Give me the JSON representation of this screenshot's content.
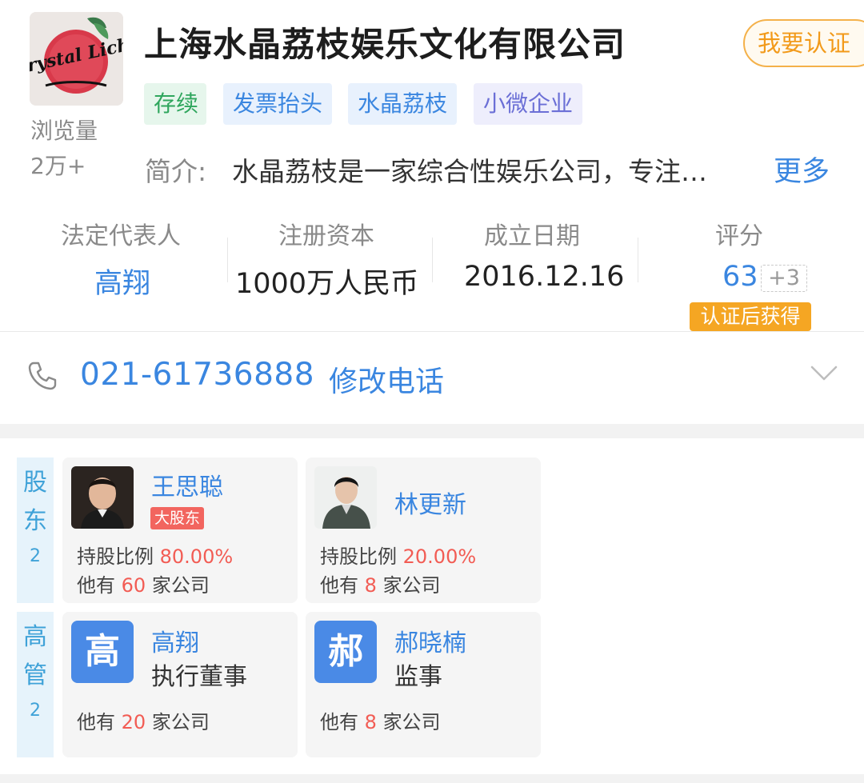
{
  "header": {
    "logo_text": "Crystal Lichi",
    "views_label": "浏览量",
    "views_count": "2万+",
    "company_name": "上海水晶荔枝娱乐文化有限公司",
    "verify_button": "我要认证",
    "tags": [
      "存续",
      "发票抬头",
      "水晶荔枝",
      "小微企业"
    ],
    "intro_label": "简介:",
    "intro_text": "水晶荔枝是一家综合性娱乐公司，专注…",
    "intro_more": "更多"
  },
  "stats": {
    "legal_rep_label": "法定代表人",
    "legal_rep_value": "高翔",
    "capital_label": "注册资本",
    "capital_value": "1000万人民币",
    "founded_label": "成立日期",
    "founded_value": "2016.12.16",
    "score_label": "评分",
    "score_value": "63",
    "score_plus": "+3",
    "score_badge": "认证后获得"
  },
  "phone": {
    "number": "021-61736888",
    "edit_label": "修改电话"
  },
  "shareholders": {
    "label_1": "股",
    "label_2": "东",
    "count": "2",
    "items": [
      {
        "name": "王思聪",
        "badge": "大股东",
        "ratio_label": "持股比例",
        "ratio": "80.00%",
        "other_prefix": "他有",
        "other_count": "60",
        "other_suffix": "家公司"
      },
      {
        "name": "林更新",
        "ratio_label": "持股比例",
        "ratio": "20.00%",
        "other_prefix": "他有",
        "other_count": "8",
        "other_suffix": "家公司"
      }
    ]
  },
  "executives": {
    "label_1": "高",
    "label_2": "管",
    "count": "2",
    "items": [
      {
        "avatar_char": "高",
        "name": "高翔",
        "role": "执行董事",
        "other_prefix": "他有",
        "other_count": "20",
        "other_suffix": "家公司"
      },
      {
        "avatar_char": "郝",
        "name": "郝晓楠",
        "role": "监事",
        "other_prefix": "他有",
        "other_count": "8",
        "other_suffix": "家公司"
      }
    ]
  },
  "colors": {
    "accent_blue": "#3a86e0",
    "highlight_red": "#f25c54",
    "badge_orange": "#f5a623",
    "tag_green": "#2fa65d"
  }
}
